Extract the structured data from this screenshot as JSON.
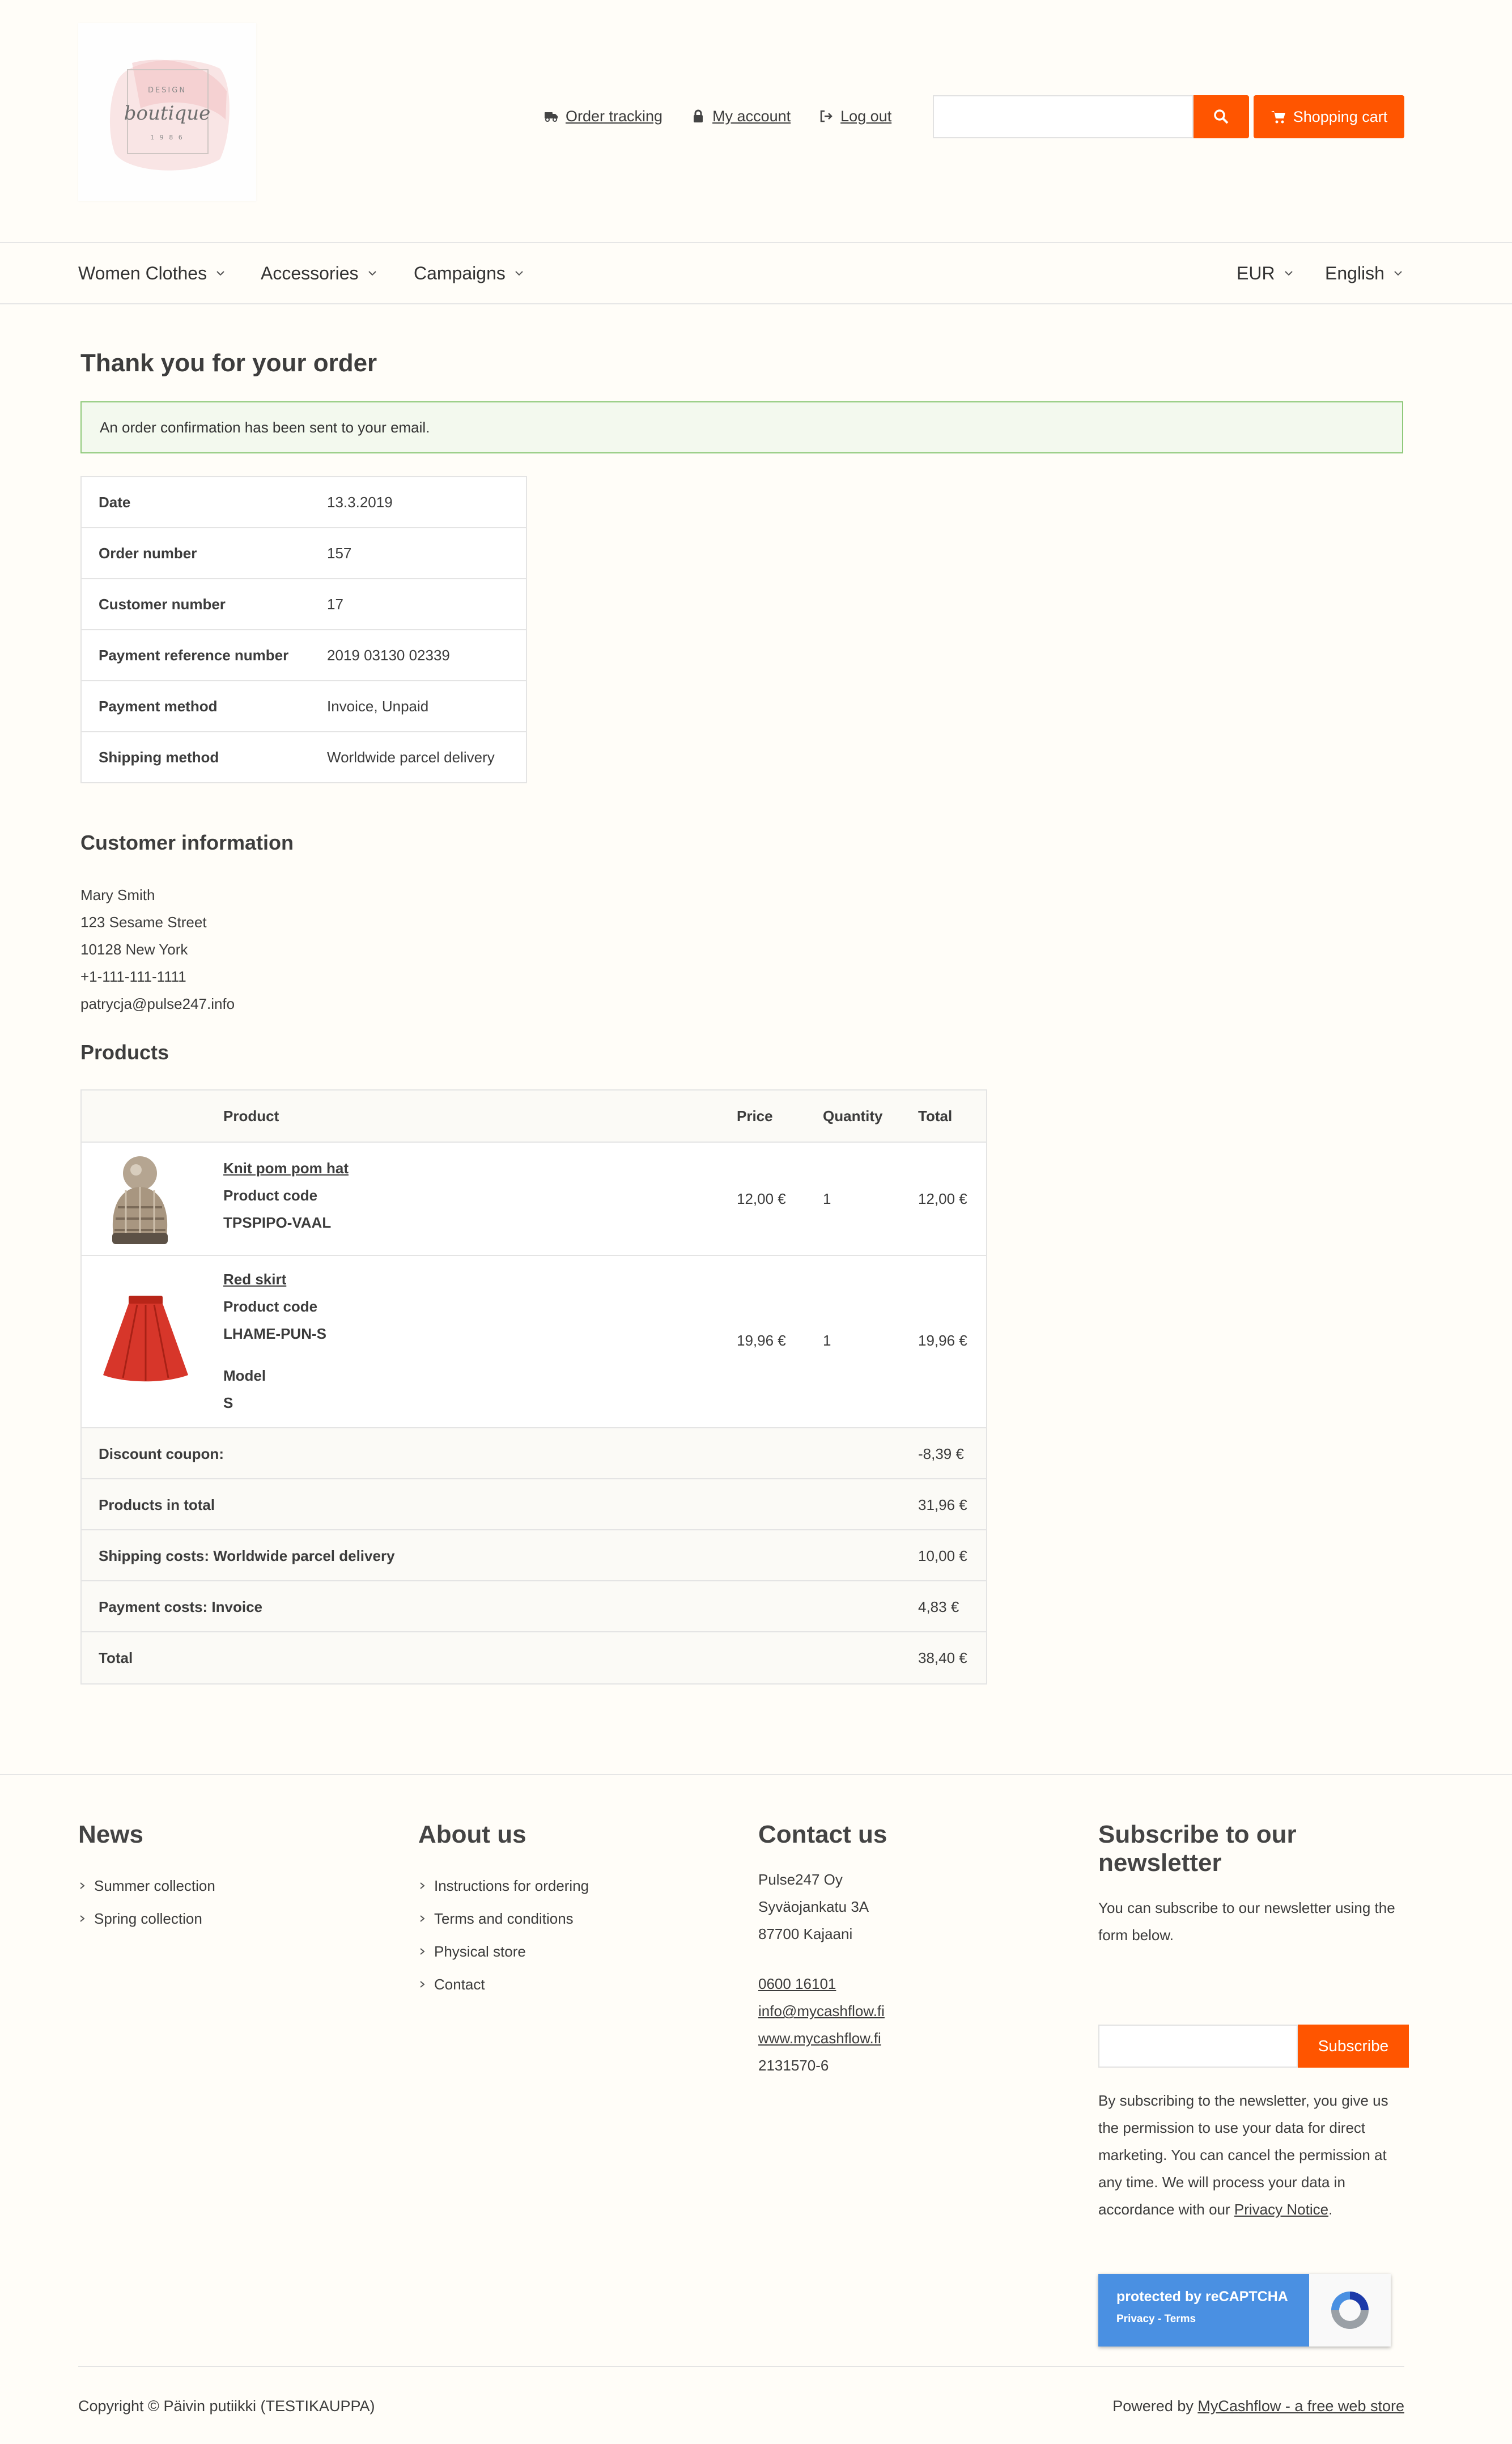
{
  "logo": {
    "line1": "DESIGN",
    "line2": "boutique",
    "line3": "1 9 8 6"
  },
  "header": {
    "links": [
      {
        "label": "Order tracking",
        "icon": "truck-icon"
      },
      {
        "label": "My account",
        "icon": "lock-icon"
      },
      {
        "label": "Log out",
        "icon": "logout-icon"
      }
    ],
    "search_placeholder": "",
    "cart_label": "Shopping cart"
  },
  "nav": {
    "items": [
      "Women Clothes",
      "Accessories",
      "Campaigns"
    ],
    "currency": "EUR",
    "language": "English"
  },
  "main": {
    "title": "Thank you for your order",
    "alert": "An order confirmation has been sent to your email.",
    "order_info": [
      {
        "key": "Date",
        "value": "13.3.2019"
      },
      {
        "key": "Order number",
        "value": "157"
      },
      {
        "key": "Customer number",
        "value": "17"
      },
      {
        "key": "Payment reference number",
        "value": "2019 03130 02339"
      },
      {
        "key": "Payment method",
        "value": "Invoice, Unpaid"
      },
      {
        "key": "Shipping method",
        "value": "Worldwide parcel delivery"
      }
    ],
    "customer_title": "Customer information",
    "customer": {
      "name": "Mary Smith",
      "street": "123 Sesame Street",
      "city": "10128 New York",
      "phone": "+1-111-111-1111",
      "email": "patrycja@pulse247.info"
    },
    "products_title": "Products",
    "products_headers": {
      "product": "Product",
      "price": "Price",
      "quantity": "Quantity",
      "total": "Total"
    },
    "products": [
      {
        "name": "Knit pom pom hat",
        "code_label": "Product code",
        "code": "TPSPIPO-VAAL",
        "price": "12,00 €",
        "qty": "1",
        "total": "12,00 €"
      },
      {
        "name": "Red skirt",
        "code_label": "Product code",
        "code": "LHAME-PUN-S",
        "model_label": "Model",
        "model": "S",
        "price": "19,96 €",
        "qty": "1",
        "total": "19,96 €"
      }
    ],
    "summary": [
      {
        "label": "Discount coupon:",
        "value": "-8,39 €"
      },
      {
        "label": "Products in total",
        "value": "31,96 €"
      },
      {
        "label": "Shipping costs: Worldwide parcel delivery",
        "value": "10,00 €"
      },
      {
        "label": "Payment costs: Invoice",
        "value": "4,83 €"
      },
      {
        "label": "Total",
        "value": "38,40 €"
      }
    ]
  },
  "footer": {
    "news": {
      "title": "News",
      "items": [
        "Summer collection",
        "Spring collection"
      ]
    },
    "about": {
      "title": "About us",
      "items": [
        "Instructions for ordering",
        "Terms and conditions",
        "Physical store",
        "Contact"
      ]
    },
    "contact": {
      "title": "Contact us",
      "company": "Pulse247 Oy",
      "street": "Syväojankatu 3A",
      "city": "87700 Kajaani",
      "phone": "0600 16101",
      "email": "info@mycashflow.fi",
      "web": "www.mycashflow.fi",
      "business_id": "2131570-6"
    },
    "newsletter": {
      "title": "Subscribe to our newsletter",
      "intro": "You can subscribe to our newsletter using the form below.",
      "button": "Subscribe",
      "consent": "By subscribing to the newsletter, you give us the permission to use your data for direct marketing. You can cancel the permission at any time. We will process your data in accordance with our ",
      "privacy_link": "Privacy Notice",
      "period": "."
    },
    "recaptcha": {
      "line1": "protected by reCAPTCHA",
      "line2": "Privacy - Terms"
    },
    "copyright": "Copyright © Päivin putiikki (TESTIKAUPPA)",
    "powered_prefix": "Powered by ",
    "powered_link": "MyCashflow - a free web store"
  },
  "colors": {
    "accent": "#ff5500",
    "alert_bg": "#f3f9ee",
    "alert_border": "#8fc97a",
    "page_bg": "#fffdf8"
  }
}
